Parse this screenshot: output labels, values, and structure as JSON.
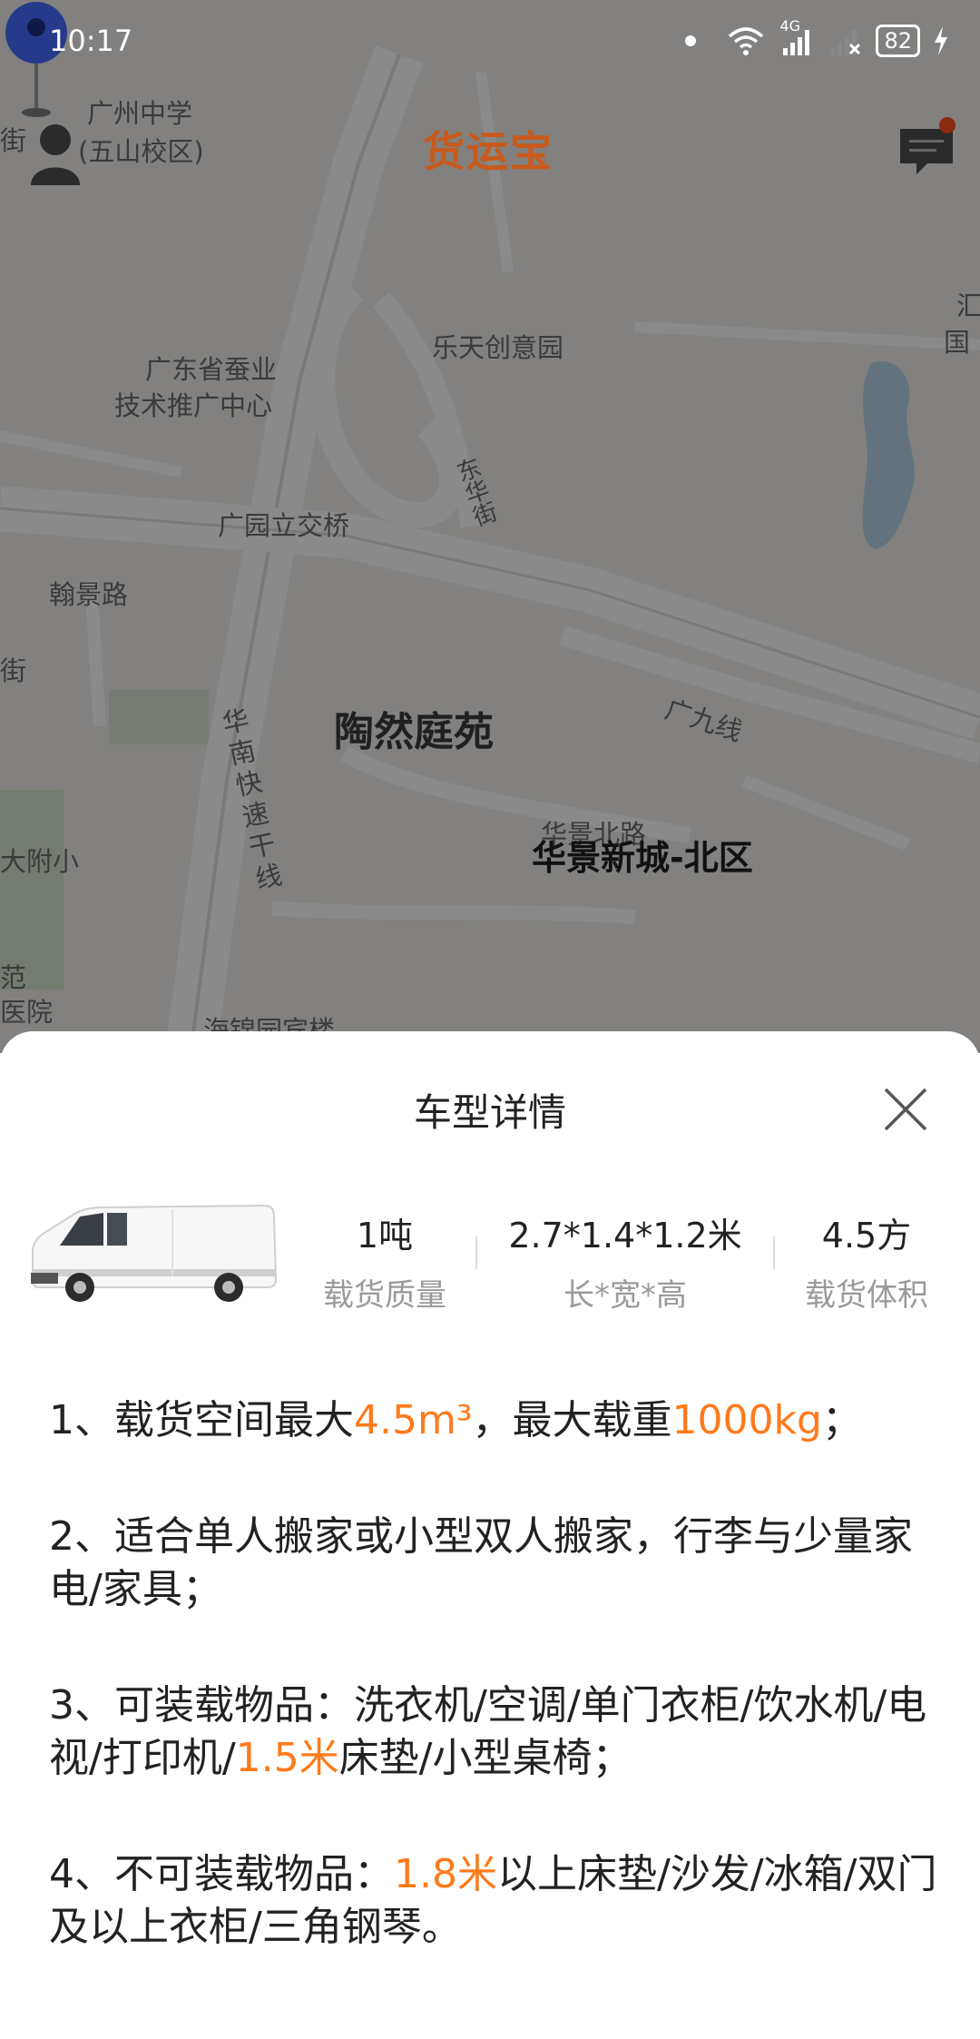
{
  "status_bar": {
    "time": "10:17",
    "network": "4G",
    "battery": "82"
  },
  "header": {
    "app_name": "货运宝",
    "logo_color": "#c95a1b"
  },
  "map": {
    "labels": [
      "广州中学",
      "(五山校区)",
      "乐天创意园",
      "广东省蚕业",
      "技术推广中心",
      "广园立交桥",
      "翰景路",
      "华南快速干线",
      "陶然庭苑",
      "广九线",
      "华景北路",
      "大附小",
      "汇",
      "国",
      "范",
      "医院",
      "海锦园宾楼",
      "街",
      "街",
      "东华街"
    ],
    "pin_label": "华景新城-北区",
    "pin_color": "#2b3f9e"
  },
  "sheet": {
    "title": "车型详情",
    "specs": [
      {
        "value": "1吨",
        "label": "载货质量"
      },
      {
        "value": "2.7*1.4*1.2米",
        "label": "长*宽*高"
      },
      {
        "value": "4.5方",
        "label": "载货体积"
      }
    ],
    "details": [
      {
        "before": "1、载货空间最大",
        "hl1": "4.5m³",
        "mid": "，最大载重",
        "hl2": "1000kg",
        "after": "；"
      },
      {
        "text": "2、适合单人搬家或小型双人搬家，行李与少量家电/家具；"
      },
      {
        "before": "3、可装载物品：洗衣机/空调/单门衣柜/饮水机/电视/打印机/",
        "hl1": "1.5米",
        "after": "床垫/小型桌椅；"
      },
      {
        "before": "4、不可装载物品：",
        "hl1": "1.8米",
        "after": "以上床垫/沙发/冰箱/双门及以上衣柜/三角钢琴。"
      }
    ],
    "highlight_color": "#ff7a1a"
  }
}
